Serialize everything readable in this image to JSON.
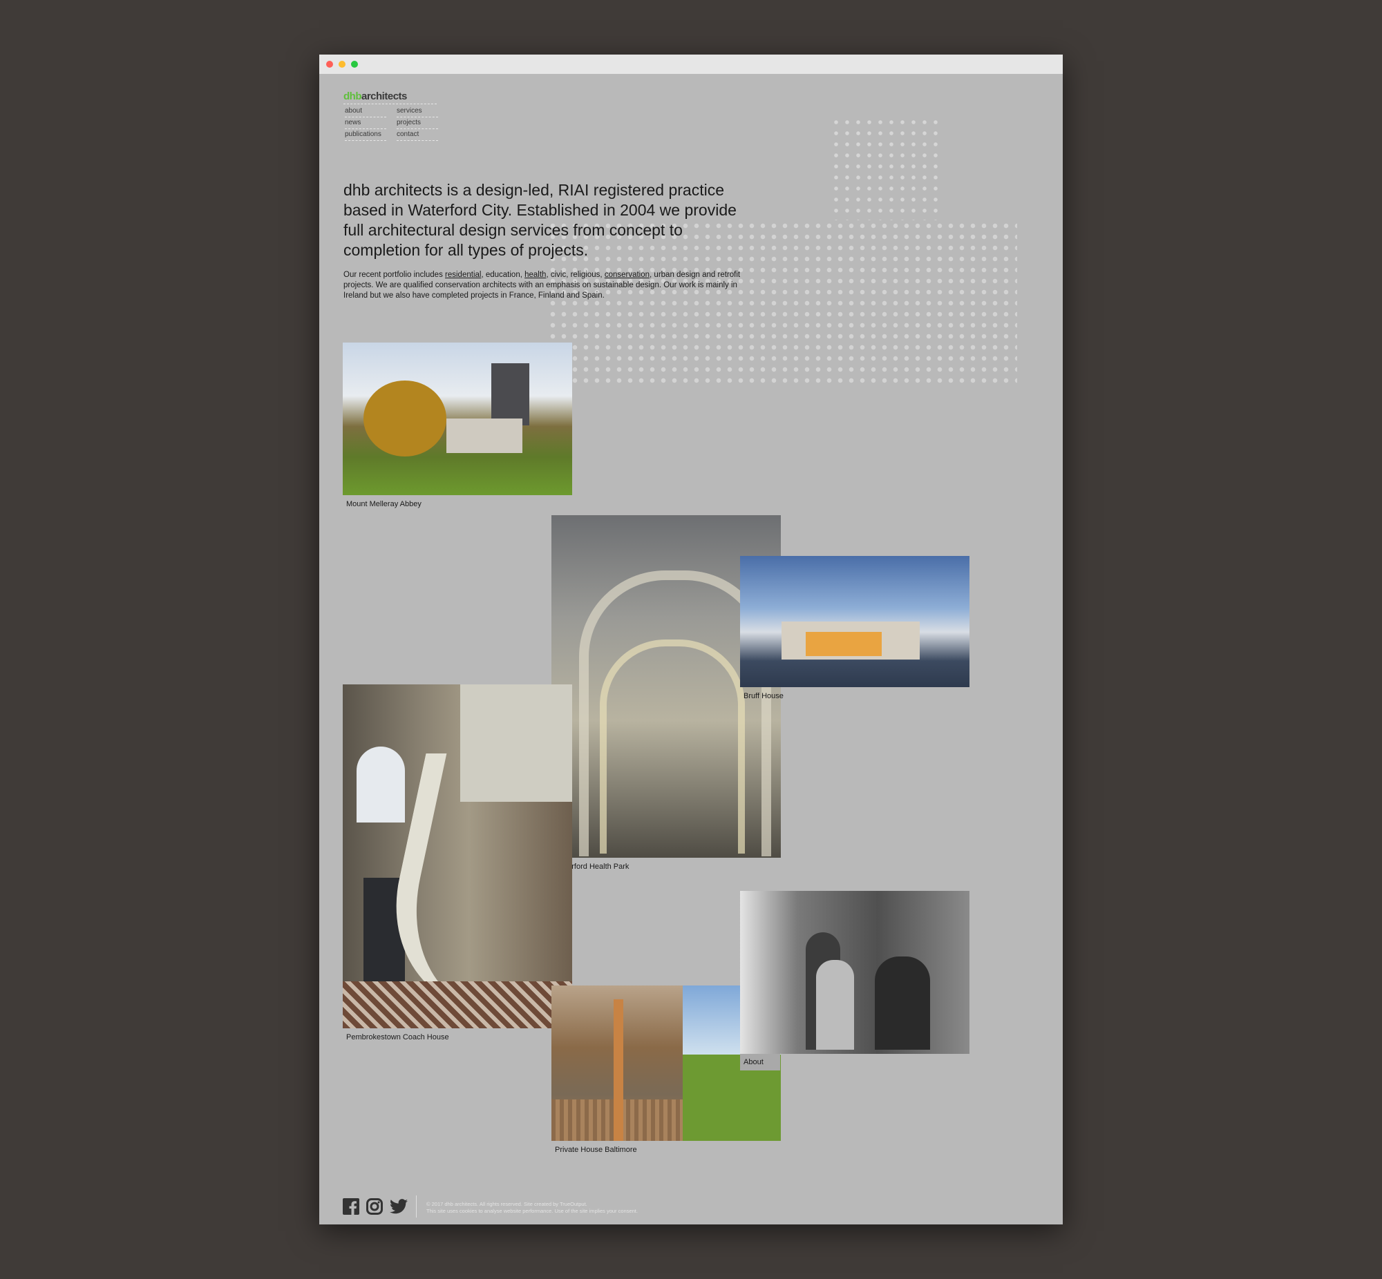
{
  "window": {
    "controls": [
      "close",
      "minimize",
      "maximize"
    ],
    "colors": {
      "close": "#fe5f57",
      "minimize": "#febc2e",
      "maximize": "#28c840"
    }
  },
  "logo": {
    "prefix": "dhb",
    "suffix": "architects",
    "accent": "#5fbf3c"
  },
  "nav": {
    "items": [
      {
        "label": "about"
      },
      {
        "label": "news"
      },
      {
        "label": "publications"
      },
      {
        "label": "services"
      },
      {
        "label": "projects"
      },
      {
        "label": "contact"
      }
    ]
  },
  "intro": {
    "headline": "dhb architects is a design-led, RIAI registered practice based in Waterford City. Established in 2004 we provide full architectural design services from concept to completion for all types of projects.",
    "p_start": "Our recent portfolio includes ",
    "link_residential": "residential",
    "p_a": ", education, ",
    "link_health": "health",
    "p_b": ", civic, religious, ",
    "link_conservation": "conservation",
    "p_end": ", urban design and retrofit projects. We are qualified conservation architects with an emphasis on sustainable design. Our work is mainly in Ireland but we also have completed projects in France, Finland and Spain."
  },
  "projects": [
    {
      "caption": "Mount Melleray Abbey"
    },
    {
      "caption": "Waterford Health Park"
    },
    {
      "caption": "Bruff House"
    },
    {
      "caption": "Pembrokestown Coach House"
    },
    {
      "caption": "About"
    },
    {
      "caption": "Private House Baltimore"
    }
  ],
  "footer": {
    "icons": [
      "facebook-icon",
      "instagram-icon",
      "twitter-icon"
    ],
    "copyright": "© 2017 dhb architects. All rights reserved. Site created by TrueOutput.",
    "cookies": "This site uses cookies to analyse website performance. Use of the site implies your consent."
  }
}
